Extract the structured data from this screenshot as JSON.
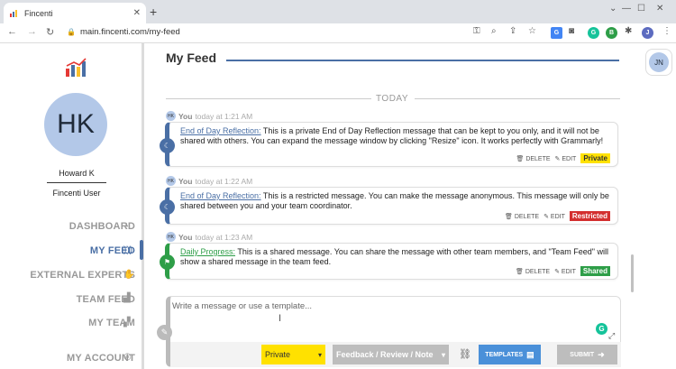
{
  "browser": {
    "tab_title": "Fincenti",
    "url": "main.fincenti.com/my-feed",
    "profile_initial": "J"
  },
  "sidebar": {
    "user_initials": "HK",
    "user_name": "Howard K",
    "user_role": "Fincenti User",
    "items": [
      {
        "label": "DASHBOARD",
        "icon": "gauge-icon"
      },
      {
        "label": "MY FEED",
        "icon": "rss-icon",
        "active": true
      },
      {
        "label": "EXTERNAL EXPERTS",
        "icon": "handshake-icon"
      },
      {
        "label": "TEAM FEED",
        "icon": "chart-icon"
      },
      {
        "label": "MY TEAM",
        "icon": "team-icon"
      },
      {
        "label": "MY ACCOUNT",
        "icon": "user-circle-icon"
      }
    ]
  },
  "header": {
    "title": "My Feed",
    "user_initials": "JN"
  },
  "feed": {
    "day_label": "TODAY",
    "messages": [
      {
        "author": "You",
        "time": "today at 1:21 AM",
        "avatar": "HK",
        "category": "End of Day Reflection:",
        "text": "This is a private End of Day Reflection message that can be kept to you only, and it will not be shared with others. You can expand the message window by clicking \"Resize\" icon. It works perfectly with Grammarly!",
        "delete_label": "DELETE",
        "edit_label": "EDIT",
        "badge": "Private",
        "color": "#4a6fa5",
        "badge_bg": "#ffe100",
        "badge_fg": "#333333"
      },
      {
        "author": "You",
        "time": "today at 1:22 AM",
        "avatar": "HK",
        "category": "End of Day Reflection:",
        "text": "This is a restricted message. You can make the message anonymous. This message will only be shared between you and your team coordinator.",
        "delete_label": "DELETE",
        "edit_label": "EDIT",
        "badge": "Restricted",
        "color": "#4a6fa5",
        "badge_bg": "#d32f2f",
        "badge_fg": "#ffffff"
      },
      {
        "author": "You",
        "time": "today at 1:23 AM",
        "avatar": "HK",
        "category": "Daily Progress:",
        "text": "This is a shared message. You can share the message with other team members, and \"Team Feed\" will show a shared message in the team feed.",
        "delete_label": "DELETE",
        "edit_label": "EDIT",
        "badge": "Shared",
        "color": "#2e9e48",
        "badge_bg": "#2e9e48",
        "badge_fg": "#ffffff"
      }
    ]
  },
  "composer": {
    "placeholder": "Write a message or use a template...",
    "privacy_value": "Private",
    "type_value": "Feedback / Review / Note",
    "templates_label": "TEMPLATES",
    "submit_label": "SUBMIT"
  },
  "colors": {
    "accent": "#4a6fa5",
    "private": "#ffe100",
    "restricted": "#d32f2f",
    "shared": "#2e9e48"
  }
}
